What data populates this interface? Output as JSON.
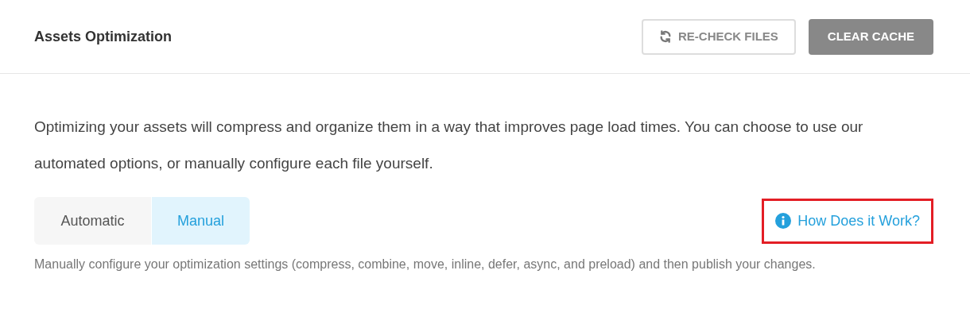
{
  "header": {
    "title": "Assets Optimization",
    "buttons": [
      {
        "kind": "outline",
        "label": "RE-CHECK FILES"
      },
      {
        "kind": "solid",
        "label": "CLEAR CACHE"
      }
    ]
  },
  "description": "Optimizing your assets will compress and organize them in a way that improves page load times. You can choose to use our automated options, or manually configure each file yourself.",
  "tabs": [
    {
      "label": "Automatic",
      "selected": false
    },
    {
      "label": "Manual",
      "selected": true
    }
  ],
  "help_link": {
    "label": "How Does it Work?",
    "highlighted": true
  },
  "tab_description": "Manually configure your optimization settings (compress, combine, move, inline, defer, async, and preload) and then publish your changes."
}
